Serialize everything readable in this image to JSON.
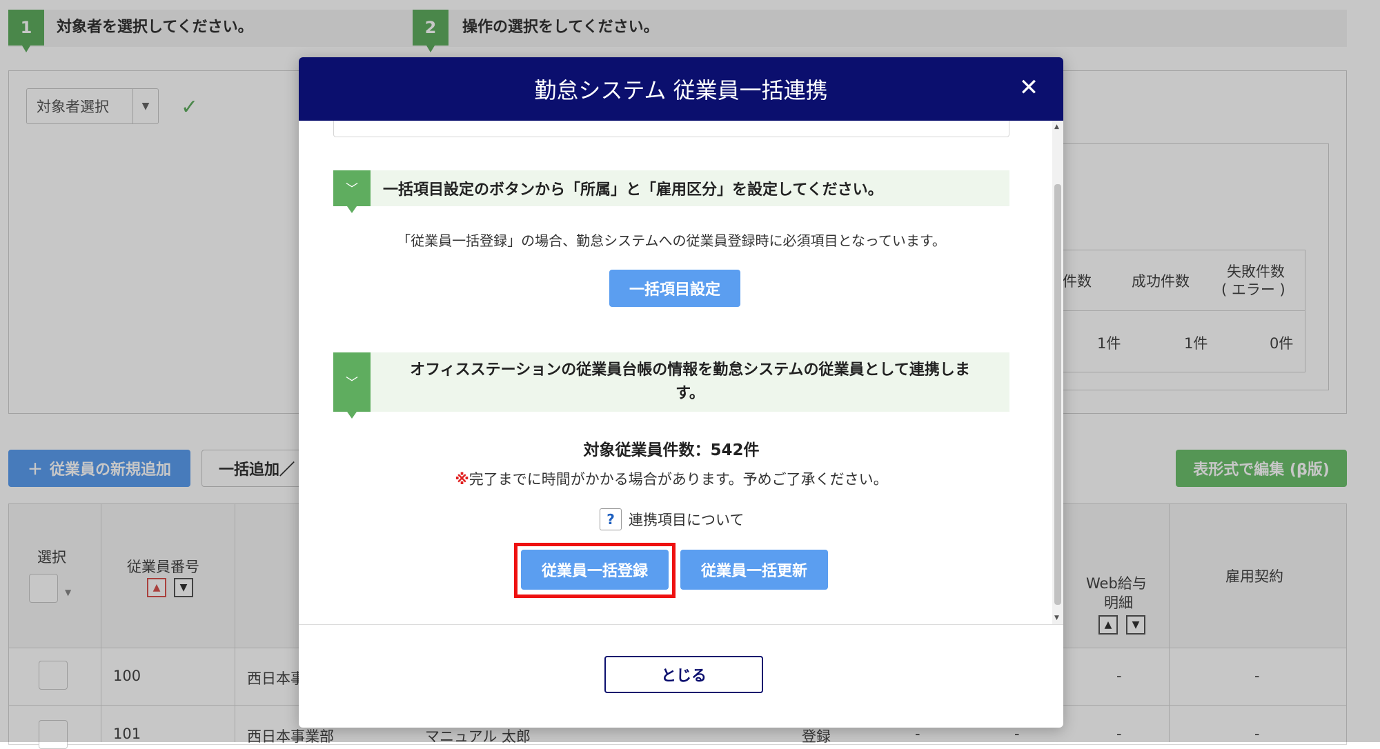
{
  "steps": [
    {
      "number": "1",
      "label": "対象者を選択してください。"
    },
    {
      "number": "2",
      "label": "操作の選択をしてください。"
    }
  ],
  "target_select": {
    "value": "対象者選択"
  },
  "stats": {
    "headers": [
      "件数",
      "成功件数",
      "失敗件数\n( エラー )"
    ],
    "header_partial": "件数",
    "header_success": "成功件数",
    "header_fail_1": "失敗件数",
    "header_fail_2": "( エラー )",
    "values": [
      "1件",
      "1件",
      "0件"
    ]
  },
  "toolbar": {
    "add_label": "従業員の新規追加",
    "bulk_label": "一括追加／",
    "table_edit_label": "表形式で編集 (β版)"
  },
  "table": {
    "col_select": "選択",
    "col_emp_no": "従業員番号",
    "col_web_pay_1": "Web給与",
    "col_web_pay_2": "明細",
    "col_contract": "雇用契約",
    "rows": [
      {
        "emp_no": "100",
        "dept": "西日本事",
        "web_pay": "-",
        "contract": "-"
      },
      {
        "emp_no": "101",
        "dept": "西日本事業部",
        "name": "マニュアル 太郎",
        "status": "登録",
        "c1": "-",
        "c2": "-",
        "web_pay": "-",
        "contract": "-"
      }
    ]
  },
  "modal": {
    "title": "勤怠システム 従業員一括連携",
    "section1_title": "一括項目設定のボタンから「所属」と「雇用区分」を設定してください。",
    "section1_desc": "「従業員一括登録」の場合、勤怠システムへの従業員登録時に必須項目となっています。",
    "section1_button": "一括項目設定",
    "section2_title_1": "オフィスステーションの従業員台帳の情報を勤怠システムの従業員として連携しま",
    "section2_title_2": "す。",
    "count_text": "対象従業員件数：542件",
    "warning_mark": "※",
    "warning_text": "完了までに時間がかかる場合があります。予めご了承ください。",
    "help_icon_glyph": "?",
    "help_link": "連携項目について",
    "register_button": "従業員一括登録",
    "update_button": "従業員一括更新",
    "close_button": "とじる"
  },
  "colors": {
    "header_navy": "#0b0f6e",
    "accent_green": "#5fad5f",
    "button_blue": "#5b9ef0",
    "highlight_red": "#ee1111"
  }
}
